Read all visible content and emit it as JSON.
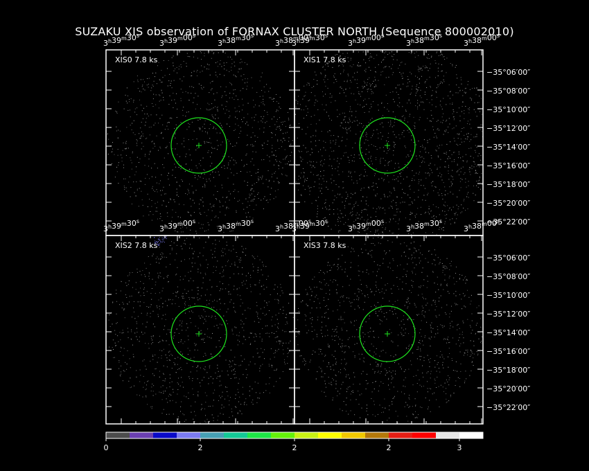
{
  "title": "SUZAKU XIS observation of FORNAX CLUSTER NORTH  (Sequence 800002010)",
  "panels": [
    {
      "label": "XIS0 7.8 ks"
    },
    {
      "label": "XIS1 7.8 ks"
    },
    {
      "label": "XIS2 7.8 ks"
    },
    {
      "label": "XIS3 7.8 ks"
    }
  ],
  "ra_ticks": [
    {
      "h": "3",
      "m": "39",
      "s": "30"
    },
    {
      "h": "3",
      "m": "39",
      "s": "00"
    },
    {
      "h": "3",
      "m": "38",
      "s": "30"
    },
    {
      "h": "3",
      "m": "38",
      "s": "00"
    }
  ],
  "dec_ticks": [
    "−35°06′00″",
    "−35°08′00″",
    "−35°10′00″",
    "−35°12′00″",
    "−35°14′00″",
    "−35°16′00″",
    "−35°18′00″",
    "−35°20′00″",
    "−35°22′00″"
  ],
  "colorbar": {
    "colors": [
      "#4d4d4d",
      "#6a3fb0",
      "#0a0ac8",
      "#7b7bf0",
      "#46a0b4",
      "#14c896",
      "#1ee646",
      "#64f00a",
      "#c8f014",
      "#ffff00",
      "#f0c800",
      "#b4780a",
      "#e61e14",
      "#ff0000",
      "#e6e6e6",
      "#ffffff"
    ],
    "tick_labels": [
      "0",
      "2",
      "2",
      "2",
      "3"
    ]
  },
  "chart_data": {
    "type": "heatmap",
    "title": "SUZAKU XIS observation of FORNAX CLUSTER NORTH  (Sequence 800002010)",
    "panels": [
      "XIS0 7.8 ks",
      "XIS1 7.8 ks",
      "XIS2 7.8 ks",
      "XIS3 7.8 ks"
    ],
    "x_ticks": [
      "3h39m30s",
      "3h39m00s",
      "3h38m30s",
      "3h38m00s"
    ],
    "y_ticks": [
      "−35°06′00″",
      "−35°08′00″",
      "−35°10′00″",
      "−35°12′00″",
      "−35°14′00″",
      "−35°16′00″",
      "−35°18′00″",
      "−35°20′00″",
      "−35°22′00″"
    ],
    "colorbar_ticks": [
      "0",
      "2",
      "2",
      "2",
      "3"
    ],
    "marker": "green circle with cross at field center"
  }
}
